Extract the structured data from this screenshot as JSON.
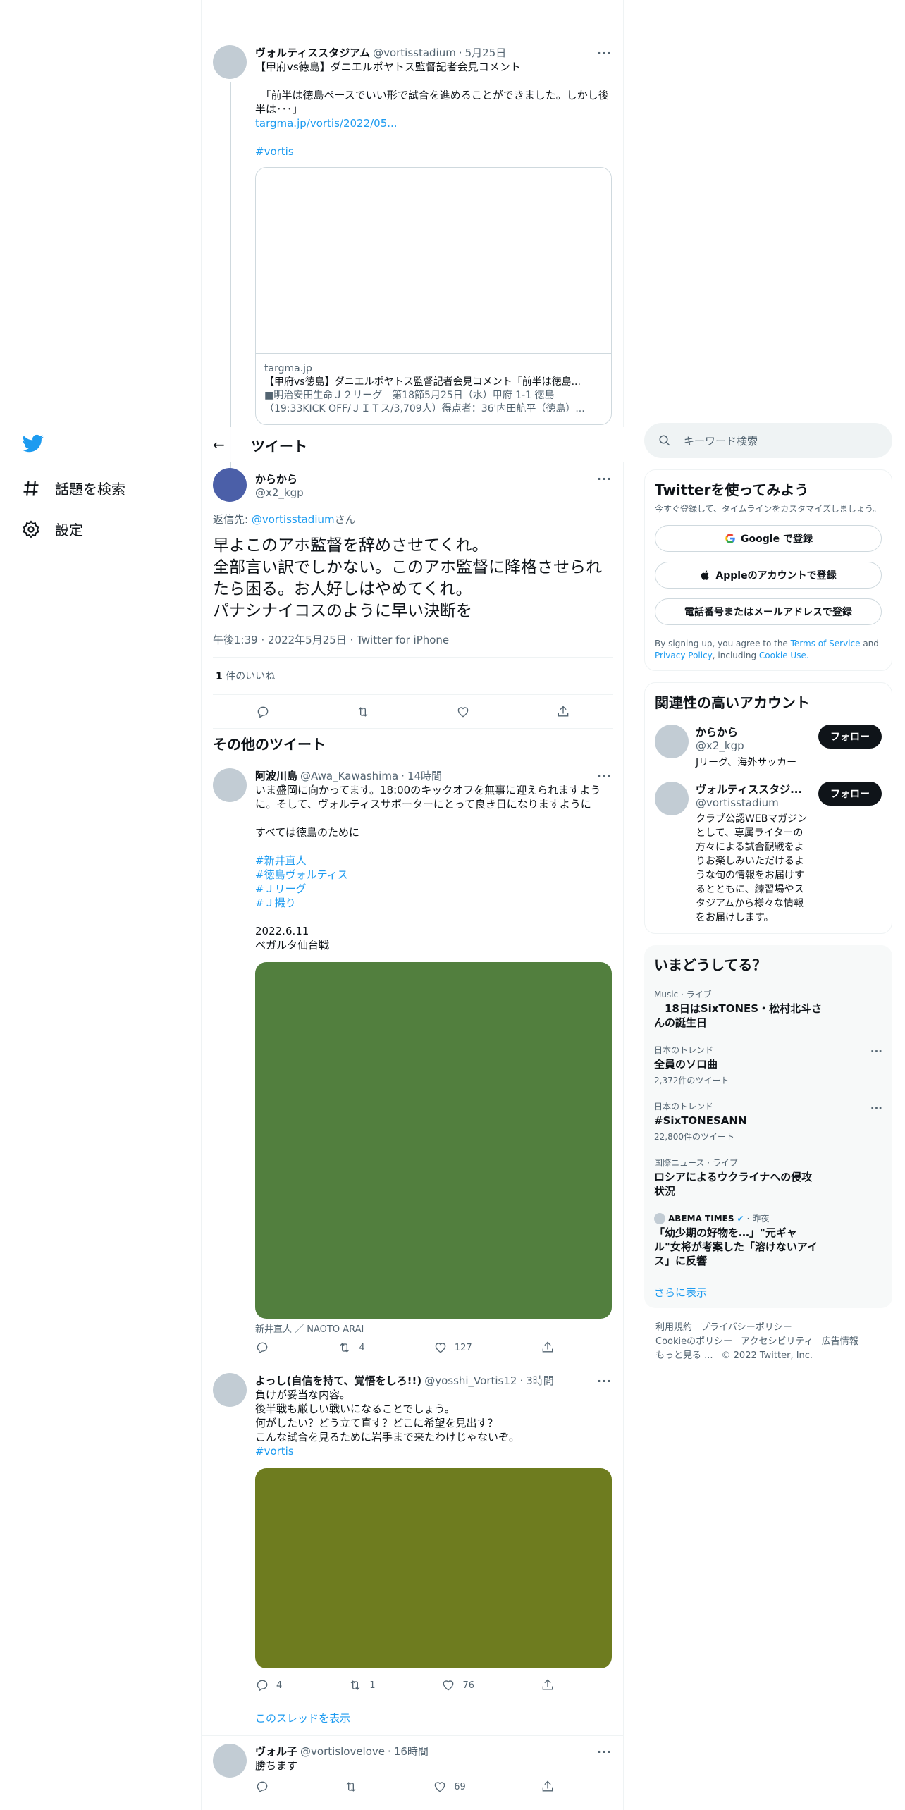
{
  "nav": {
    "explore": "話題を検索",
    "settings": "設定"
  },
  "parent": {
    "name": "ヴォルティススタジアム",
    "handle": "@vortisstadium",
    "time": "5月25日",
    "text1": "【甲府vs徳島】ダニエルポヤトス監督記者会見コメント",
    "text2": "　「前半は徳島ペースでいい形で試合を進めることができました。しかし後半は･･･」",
    "link": "targma.jp/vortis/2022/05...",
    "hashtag": "#vortis",
    "card_domain": "targma.jp",
    "card_title": "【甲府vs徳島】ダニエルポヤトス監督記者会見コメント「前半は徳島...",
    "card_desc": "■明治安田生命Ｊ２リーグ　第18節5月25日（水）甲府 1-1 徳島（19:33KICK OFF/ＪＩＴス/3,709人）得点者：36'内田航平（徳島）..."
  },
  "header": {
    "back": "←",
    "title": "ツイート"
  },
  "main": {
    "name": "からから",
    "handle": "@x2_kgp",
    "reply_label": "返信先: ",
    "reply_handle": "@vortisstadium",
    "reply_suffix": "さん",
    "text": "早よこのアホ監督を辞めさせてくれ。\n全部言い訳でしかない。このアホ監督に降格させられたら困る。お人好しはやめてくれ。\nパナシナイコスのように早い決断を",
    "time": "午後1:39 · 2022年5月25日 · Twitter for iPhone",
    "likes_count": "1",
    "likes_label": " 件のいいね"
  },
  "more_title": "その他のツイート",
  "tweets": [
    {
      "name": "阿波川島",
      "handle": "@Awa_Kawashima",
      "time": "14時間",
      "text": "いま盛岡に向かってます。18:00のキックオフを無事に迎えられますように。そして、ヴォルティスサポーターにとって良き日になりますように\n\nすべては徳島のために",
      "tags": [
        "#新井直人",
        "#徳島ヴォルティス",
        "#Ｊリーグ",
        "#Ｊ撮り"
      ],
      "text2": "2022.6.11\nベガルタ仙台戦",
      "caption": "新井直人 ／ NAOTO ARAI",
      "retweets": "4",
      "likes": "127",
      "image_color": "#527f3e"
    },
    {
      "name": "よっし(自信を持て、覚悟をしろ!!)",
      "handle": "@yosshi_Vortis12",
      "time": "3時間",
      "text": "負けが妥当な内容。\n後半戦も厳しい戦いになることでしょう。\n何がしたい？どう立て直す？どこに希望を見出す？\nこんな試合を見るために岩手まで来たわけじゃないぞ。",
      "tag": "#vortis",
      "replies": "4",
      "retweets": "1",
      "likes": "76",
      "thread": "このスレッドを表示",
      "image_color": "#6e7c1f"
    },
    {
      "name": "ヴォル子",
      "handle": "@vortislovelove",
      "time": "16時間",
      "text": "勝ちます",
      "likes": "69"
    }
  ],
  "right": {
    "search_placeholder": "キーワード検索",
    "signup_title": "Twitterを使ってみよう",
    "signup_sub": "今すぐ登録して、タイムラインをカスタマイズしましょう。",
    "google": "Google で登録",
    "apple": "Appleのアカウントで登録",
    "phone": "電話番号またはメールアドレスで登録",
    "terms_prefix": "By signing up, you agree to the ",
    "terms": "Terms of Service",
    "and": " and ",
    "privacy": "Privacy Policy",
    "including": ", including ",
    "cookie": "Cookie Use.",
    "related_title": "関連性の高いアカウント",
    "accounts": [
      {
        "name": "からから",
        "handle": "@x2_kgp",
        "bio": "Jリーグ、海外サッカー",
        "follow": "フォロー"
      },
      {
        "name": "ヴォルティススタジ...",
        "handle": "@vortisstadium",
        "bio": "クラブ公認WEBマガジンとして、専属ライターの方々による試合観戦をよりお楽しみいただけるような旬の情報をお届けするとともに、練習場やスタジアムから様々な情報をお届けします。",
        "follow": "フォロー"
      }
    ],
    "trends_title": "いまどうしてる？",
    "trends": [
      {
        "cat": "Music · ライブ",
        "title": "　18日はSixTONES・松村北斗さんの誕生日",
        "count": ""
      },
      {
        "cat": "日本のトレンド",
        "title": "全員のソロ曲",
        "count": "2,372件のツイート"
      },
      {
        "cat": "日本のトレンド",
        "title": "#SixTONESANN",
        "count": "22,800件のツイート"
      },
      {
        "cat": "国際ニュース · ライブ",
        "title": "ロシアによるウクライナへの侵攻状況",
        "count": ""
      }
    ],
    "news_source": "ABEMA TIMES",
    "news_time": "昨夜",
    "news_title": "「幼少期の好物を…」\"元ギャル\"女将が考案した「溶けないアイス」に反響",
    "show_more": "さらに表示",
    "footer": {
      "l1": [
        "利用規約",
        "プライバシーポリシー"
      ],
      "l2": [
        "Cookieのポリシー",
        "アクセシビリティ",
        "広告情報"
      ],
      "l3": [
        "もっと見る ...",
        "© 2022 Twitter, Inc."
      ]
    }
  },
  "colors": {
    "accent": "#1d9bf0",
    "text": "#0f1419",
    "muted": "#536471"
  }
}
